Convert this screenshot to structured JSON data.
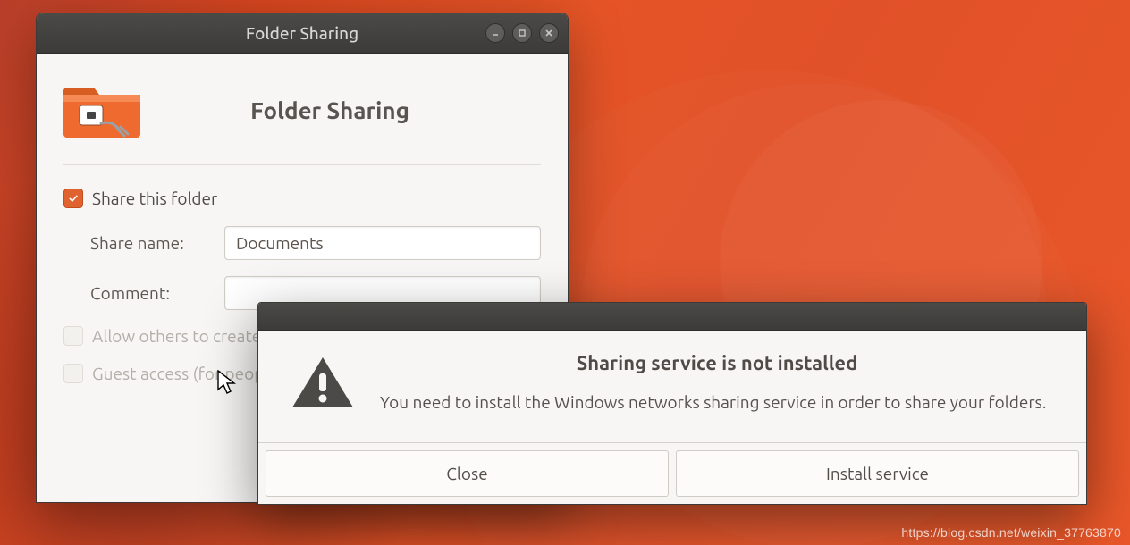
{
  "window": {
    "titlebar_title": "Folder Sharing",
    "page_title": "Folder Sharing",
    "share_this_folder_label": "Share this folder",
    "share_this_folder_checked": true,
    "share_name_label": "Share name:",
    "share_name_value": "Documents",
    "comment_label": "Comment:",
    "comment_value": "",
    "allow_others_label": "Allow others to create and delete files in this folder",
    "guest_access_label": "Guest access (for people without a user account)"
  },
  "dialog": {
    "title": "Sharing service is not installed",
    "message": "You need to install the Windows networks sharing service in order to share your folders.",
    "close_label": "Close",
    "install_label": "Install service"
  },
  "watermark": "https://blog.csdn.net/weixin_37763870"
}
